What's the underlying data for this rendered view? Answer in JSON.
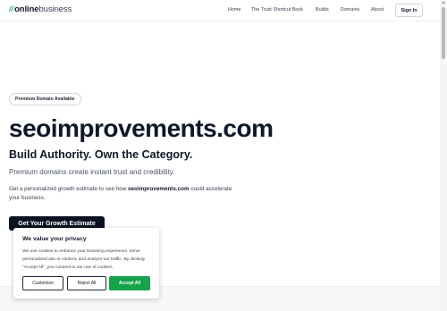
{
  "header": {
    "logo_slash": "//",
    "logo_bold": "online",
    "logo_rest": "business",
    "nav": [
      "Home",
      "The Trust Shortcut Book",
      "Builds",
      "Domains",
      "About"
    ],
    "signin_label": "Sign In"
  },
  "hero": {
    "badge": "Premium Domain Available",
    "domain": "seoimprovements.com",
    "tagline": "Build Authority. Own the Category.",
    "subline": "Premium domains create instant trust and credibility.",
    "desc_prefix": "Get a personalized growth estimate to see how ",
    "desc_domain": "seoimprovements.com",
    "desc_suffix": " could accelerate your business.",
    "cta_label": "Get Your Growth Estimate"
  },
  "cookie": {
    "title": "We value your privacy",
    "text": "We use cookies to enhance your browsing experience, serve personalized ads or content, and analyze our traffic. By clicking \"Accept All\", you consent to our use of cookies.",
    "customize_label": "Customize",
    "reject_label": "Reject All",
    "accept_label": "Accept All"
  },
  "colors": {
    "brand_green": "#22c55e",
    "accept_green": "#16a34a",
    "cta_dark": "#0b1220"
  }
}
